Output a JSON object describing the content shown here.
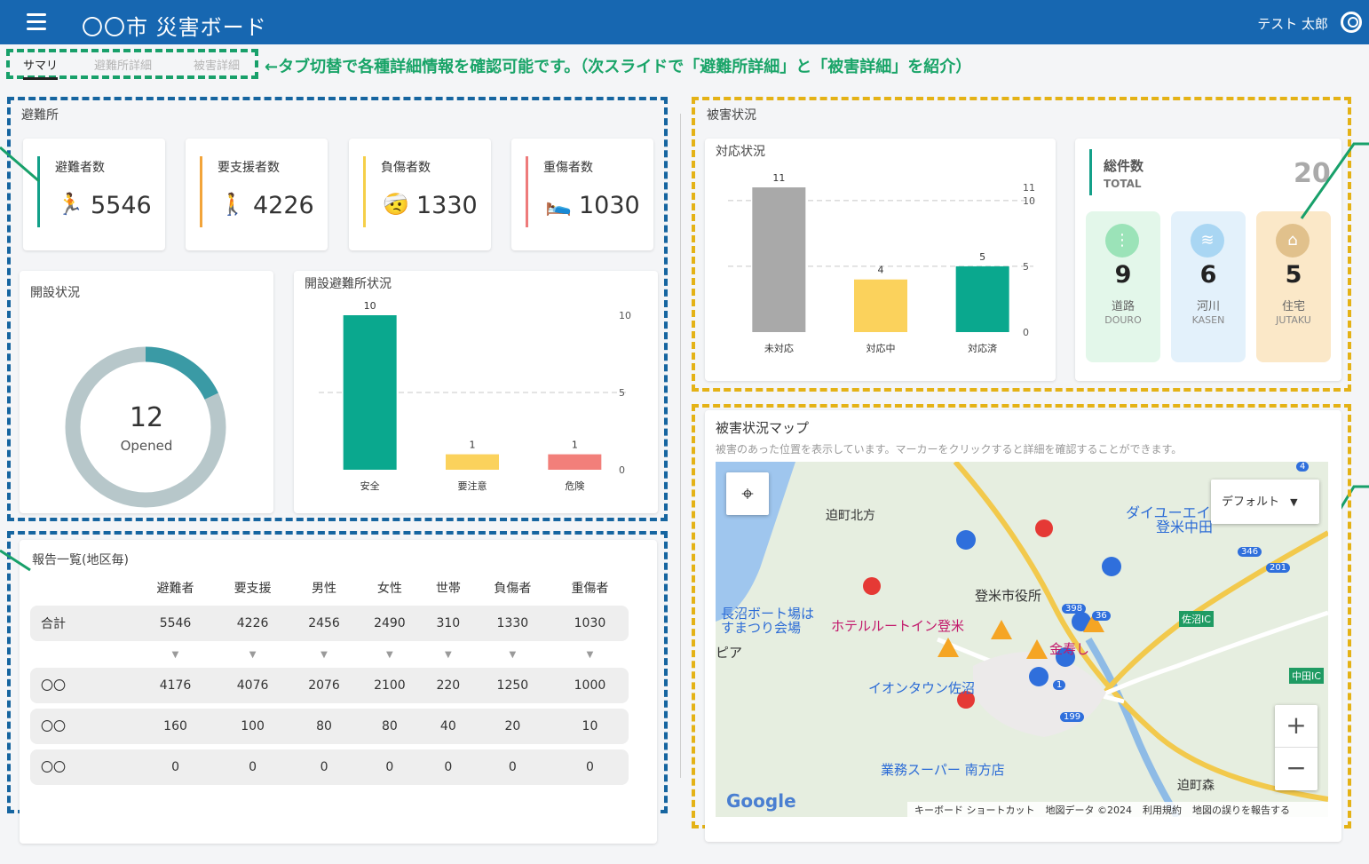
{
  "header": {
    "title": "〇〇市 災害ボード",
    "user": "テスト 太郎"
  },
  "tabs": [
    {
      "label": "サマリ",
      "active": true
    },
    {
      "label": "避難所詳細",
      "active": false
    },
    {
      "label": "被害詳細",
      "active": false
    }
  ],
  "tab_note": "←タブ切替で各種詳細情報を確認可能です。（次スライドで「避難所詳細」と「被害詳細」を紹介）",
  "shelter": {
    "title": "避難所",
    "stats": [
      {
        "label": "避難者数",
        "value": "5546",
        "icon": "walking-person-icon",
        "color": "#13a089"
      },
      {
        "label": "要支援者数",
        "value": "4226",
        "icon": "assisted-person-icon",
        "color": "#f2a43a"
      },
      {
        "label": "負傷者数",
        "value": "1330",
        "icon": "injured-person-icon",
        "color": "#f5cf48"
      },
      {
        "label": "重傷者数",
        "value": "1030",
        "icon": "severe-injury-icon",
        "color": "#ee7b7b"
      }
    ],
    "open_status": {
      "title": "開設状況",
      "count": "12",
      "sub": "Opened",
      "fraction": 0.18
    },
    "open_chart_title": "開設避難所状況"
  },
  "report": {
    "title": "報告一覧(地区毎)",
    "columns": [
      "避難者",
      "要支援",
      "男性",
      "女性",
      "世帯",
      "負傷者",
      "重傷者"
    ],
    "total": {
      "label": "合計",
      "values": [
        "5546",
        "4226",
        "2456",
        "2490",
        "310",
        "1330",
        "1030"
      ]
    },
    "rows": [
      {
        "label": "〇〇",
        "values": [
          "4176",
          "4076",
          "2076",
          "2100",
          "220",
          "1250",
          "1000"
        ]
      },
      {
        "label": "〇〇",
        "values": [
          "160",
          "100",
          "80",
          "80",
          "40",
          "20",
          "10"
        ]
      },
      {
        "label": "〇〇",
        "values": [
          "0",
          "0",
          "0",
          "0",
          "0",
          "0",
          "0"
        ]
      }
    ],
    "arrow": "▼"
  },
  "damage": {
    "title": "被害状況",
    "response_title": "対応状況",
    "total_label": "総件数",
    "total_en": "TOTAL",
    "total_value": "20",
    "categories": [
      {
        "name": "道路",
        "en": "DOURO",
        "value": "9",
        "bg": "#e3f7ea",
        "icon_bg": "#9be3b8",
        "icon": "road-icon"
      },
      {
        "name": "河川",
        "en": "KASEN",
        "value": "6",
        "bg": "#e3f1fb",
        "icon_bg": "#a9d6f3",
        "icon": "river-icon"
      },
      {
        "name": "住宅",
        "en": "JUTAKU",
        "value": "5",
        "bg": "#fbe8c8",
        "icon_bg": "#e1c18c",
        "icon": "house-icon"
      }
    ]
  },
  "map": {
    "title": "被害状況マップ",
    "description": "被害のあった位置を表示しています。マーカーをクリックすると詳細を確認することができます。",
    "dropdown": "デフォルト",
    "labels": [
      "迫町北方",
      "ダイユーエイト",
      "登米中田",
      "登米市役所",
      "長沼ボート場は",
      "すまつり会場",
      "ホテルルートイン登米",
      "ピア",
      "イオンタウン佐沼",
      "業務スーパー 南方店",
      "迫町森",
      "佐沼IC",
      "中田IC",
      "金寿し"
    ],
    "road_numbers": [
      "398",
      "36",
      "346",
      "201",
      "199",
      "1",
      "4"
    ],
    "footer": [
      "キーボード ショートカット",
      "地図データ ©2024",
      "利用規約",
      "地図の誤りを報告する"
    ],
    "google": "Google",
    "zoom_in": "+",
    "zoom_out": "−"
  },
  "chart_data": [
    {
      "type": "bar",
      "title": "開設避難所状況",
      "categories": [
        "安全",
        "要注意",
        "危険"
      ],
      "values": [
        10,
        1,
        1
      ],
      "colors": [
        "#0aa88e",
        "#fbd25c",
        "#f27f7a"
      ],
      "yticks": [
        0,
        5,
        10
      ],
      "ylim": [
        0,
        10
      ]
    },
    {
      "type": "bar",
      "title": "対応状況",
      "categories": [
        "未対応",
        "対応中",
        "対応済"
      ],
      "values": [
        11,
        4,
        5
      ],
      "colors": [
        "#a9a9a9",
        "#fbd25c",
        "#0aa88e"
      ],
      "yticks": [
        0,
        5,
        10,
        11
      ],
      "ylim": [
        0,
        11
      ]
    }
  ]
}
